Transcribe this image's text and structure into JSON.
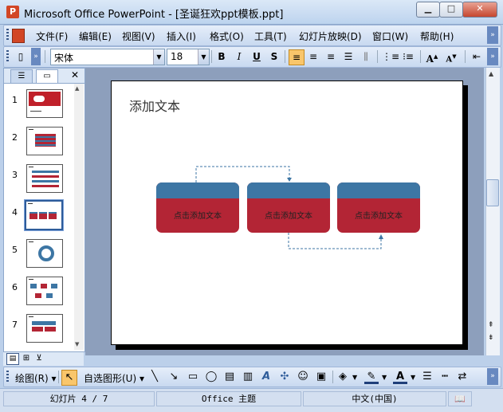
{
  "window": {
    "title": "Microsoft Office PowerPoint - [圣诞狂欢ppt模板.ppt]",
    "min": "▁",
    "max": "□",
    "close": "✕"
  },
  "menu": {
    "items": [
      "文件(F)",
      "编辑(E)",
      "视图(V)",
      "插入(I)",
      "格式(O)",
      "工具(T)",
      "幻灯片放映(D)",
      "窗口(W)",
      "帮助(H)"
    ]
  },
  "toolbar": {
    "font_name": "宋体",
    "font_size": "18",
    "bold": "B",
    "italic": "I",
    "underline": "U",
    "shadow": "S",
    "increase_font": "A",
    "decrease_font": "A"
  },
  "slides_pane": {
    "numbers": [
      "1",
      "2",
      "3",
      "4",
      "5",
      "6",
      "7"
    ],
    "selected": 4,
    "close": "✕"
  },
  "slide": {
    "title": "添加文本",
    "boxes": [
      "点击添加文本",
      "点击添加文本",
      "点击添加文本"
    ],
    "colors": {
      "cap": "#3d76a4",
      "body": "#b32535"
    }
  },
  "drawbar": {
    "draw_label": "绘图(R)",
    "autoshapes_label": "自选图形(U)"
  },
  "status": {
    "slide_info": "幻灯片 4 / 7",
    "theme": "Office 主题",
    "language": "中文(中国)"
  }
}
